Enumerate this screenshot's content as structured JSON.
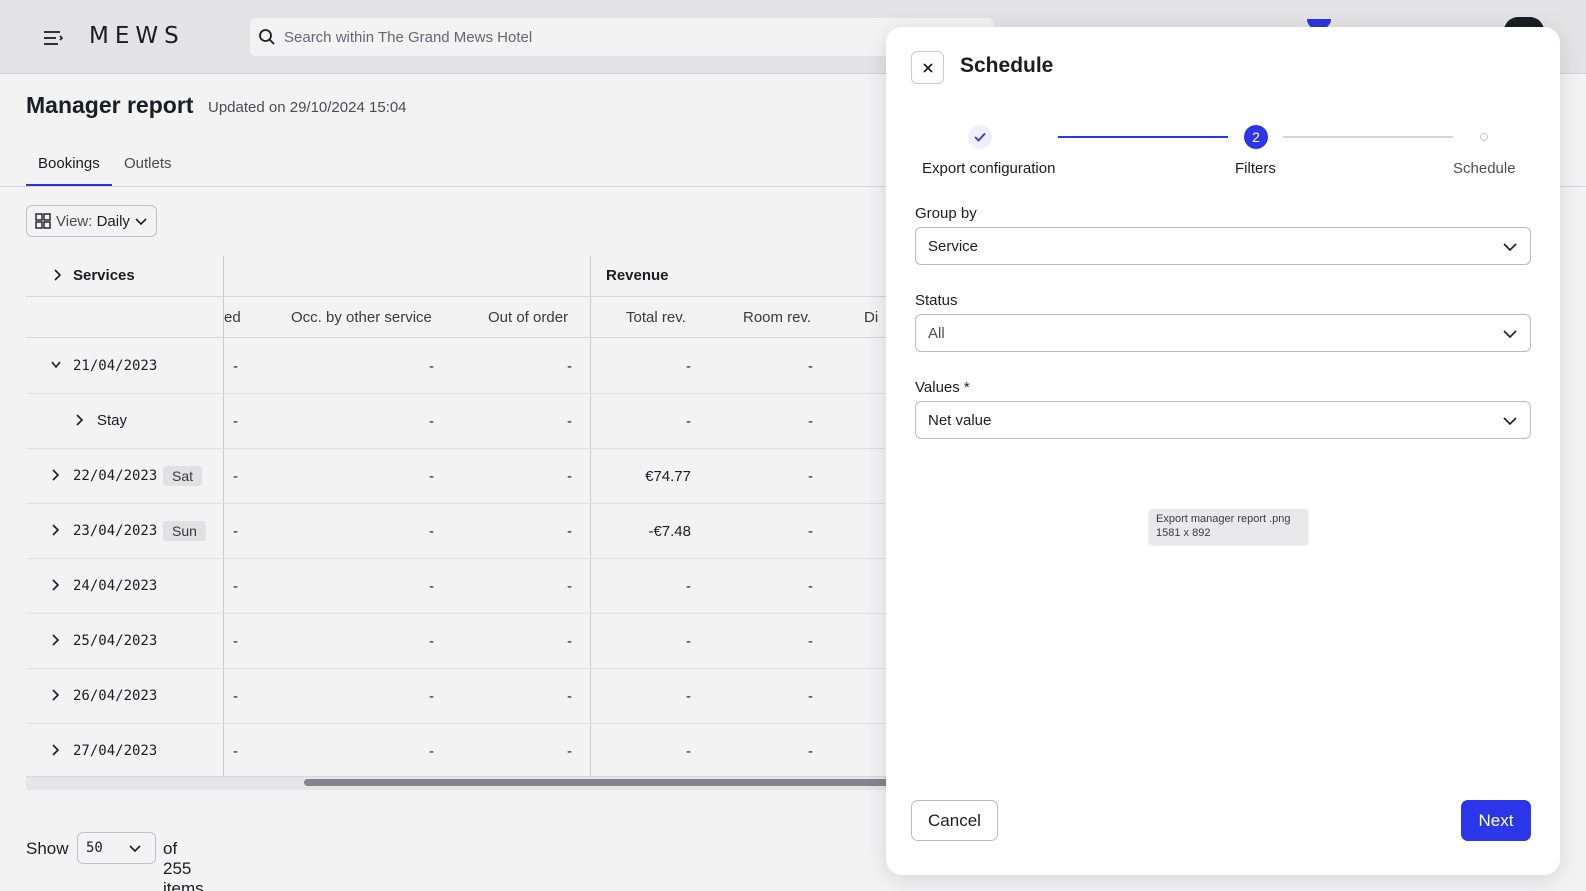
{
  "app": {
    "logo": "MEWS",
    "search_placeholder": "Search within The Grand Mews Hotel"
  },
  "page": {
    "title": "Manager report",
    "updated": "Updated on 29/10/2024 15:04",
    "tabs": [
      {
        "label": "Bookings",
        "active": true
      },
      {
        "label": "Outlets",
        "active": false
      }
    ],
    "view_key": "View:",
    "view_value": "Daily"
  },
  "table": {
    "group_headers": {
      "services": "Services",
      "revenue": "Revenue"
    },
    "columns": [
      "ed",
      "Occ. by other service",
      "Out of order",
      "Total rev.",
      "Room rev.",
      "Di"
    ],
    "rows": [
      {
        "date": "21/04/2023",
        "day": "",
        "expanded": true,
        "cells": [
          "-",
          "-",
          "-",
          "-",
          "-"
        ]
      },
      {
        "date": "Stay",
        "day": "",
        "child": true,
        "cells": [
          "-",
          "-",
          "-",
          "-",
          "-"
        ]
      },
      {
        "date": "22/04/2023",
        "day": "Sat",
        "cells": [
          "-",
          "-",
          "-",
          "€74.77",
          "-"
        ]
      },
      {
        "date": "23/04/2023",
        "day": "Sun",
        "cells": [
          "-",
          "-",
          "-",
          "-€7.48",
          "-"
        ]
      },
      {
        "date": "24/04/2023",
        "day": "",
        "cells": [
          "-",
          "-",
          "-",
          "-",
          "-"
        ]
      },
      {
        "date": "25/04/2023",
        "day": "",
        "cells": [
          "-",
          "-",
          "-",
          "-",
          "-"
        ]
      },
      {
        "date": "26/04/2023",
        "day": "",
        "cells": [
          "-",
          "-",
          "-",
          "-",
          "-"
        ]
      },
      {
        "date": "27/04/2023",
        "day": "",
        "cells": [
          "-",
          "-",
          "-",
          "-",
          "-"
        ]
      }
    ]
  },
  "pager": {
    "show": "Show",
    "page_size": "50",
    "of_items": "of 255 items"
  },
  "modal": {
    "title": "Schedule",
    "steps": [
      {
        "label": "Export configuration",
        "state": "done"
      },
      {
        "label": "Filters",
        "state": "current",
        "number": "2"
      },
      {
        "label": "Schedule",
        "state": "upcoming"
      }
    ],
    "fields": {
      "group_by_label": "Group by",
      "group_by_value": "Service",
      "status_label": "Status",
      "status_value": "All",
      "values_label": "Values *",
      "values_value": "Net value"
    },
    "tooltip_line1": "Export manager report .png",
    "tooltip_line2": "1581 x 892",
    "cancel_label": "Cancel",
    "next_label": "Next"
  },
  "colors": {
    "accent": "#2b36e8",
    "text": "#1c1d24"
  }
}
